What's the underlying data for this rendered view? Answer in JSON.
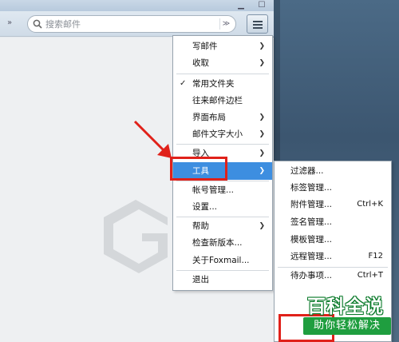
{
  "search": {
    "placeholder": "搜索邮件"
  },
  "toolbar": {
    "overflow_glyph": "»",
    "options_glyph": "≫"
  },
  "main_menu": {
    "items": [
      {
        "label": "写邮件",
        "has_submenu": true
      },
      {
        "label": "收取",
        "has_submenu": true
      },
      {
        "label": "常用文件夹",
        "checked": true
      },
      {
        "label": "往来邮件边栏"
      },
      {
        "label": "界面布局",
        "has_submenu": true
      },
      {
        "label": "邮件文字大小",
        "has_submenu": true
      },
      {
        "label": "导入",
        "has_submenu": true
      },
      {
        "label": "工具",
        "has_submenu": true,
        "highlighted": true
      },
      {
        "label": "帐号管理..."
      },
      {
        "label": "设置..."
      },
      {
        "label": "帮助",
        "has_submenu": true
      },
      {
        "label": "检查新版本..."
      },
      {
        "label": "关于Foxmail..."
      },
      {
        "label": "退出"
      }
    ]
  },
  "tools_submenu": {
    "items": [
      {
        "label": "过滤器..."
      },
      {
        "label": "标签管理..."
      },
      {
        "label": "附件管理...",
        "shortcut": "Ctrl+K"
      },
      {
        "label": "签名管理..."
      },
      {
        "label": "模板管理..."
      },
      {
        "label": "远程管理...",
        "shortcut": "F12"
      },
      {
        "label": "待办事项...",
        "shortcut": "Ctrl+T"
      }
    ]
  },
  "brand": {
    "title": "百科全说",
    "subtitle": "助你轻松解决"
  },
  "colors": {
    "highlight": "#3d8ee0",
    "annotation_red": "#e0211a",
    "brand_green": "#1f9e3f"
  }
}
